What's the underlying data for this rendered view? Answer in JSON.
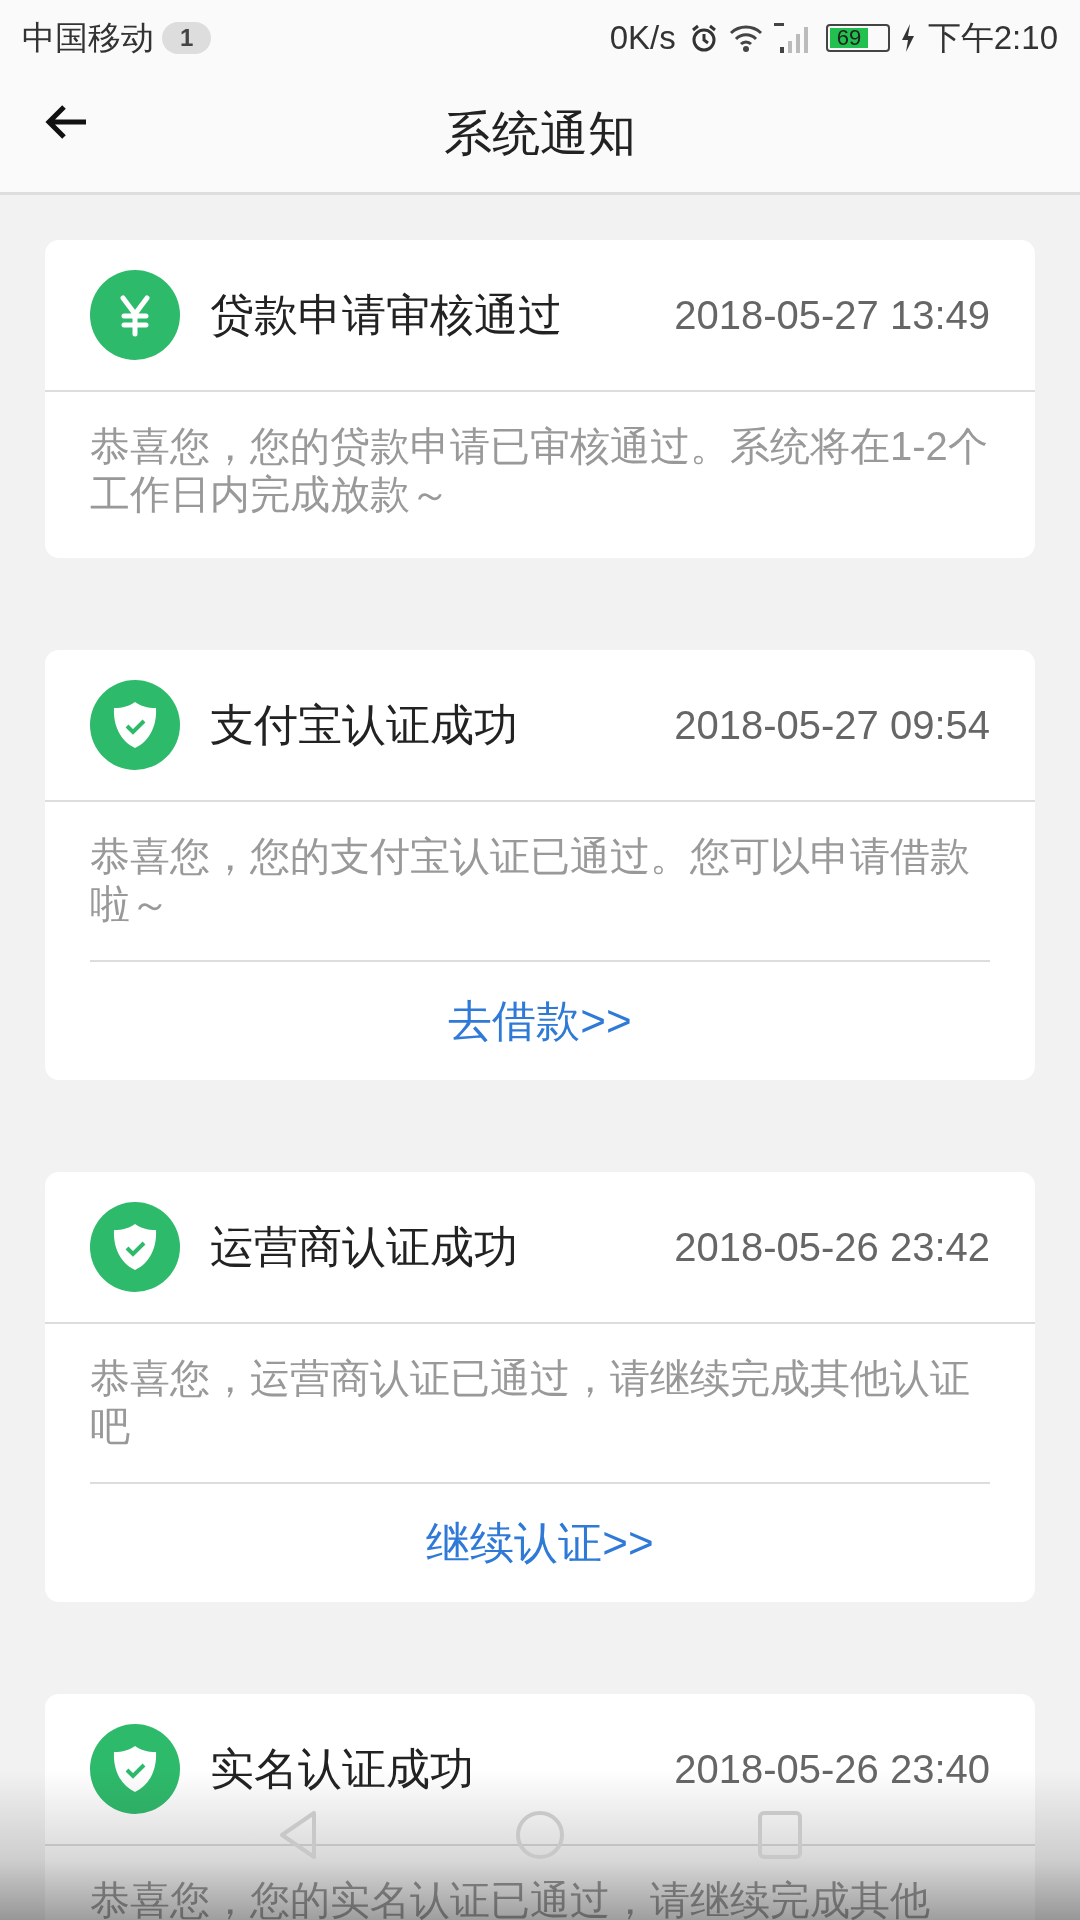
{
  "status_bar": {
    "carrier": "中国移动",
    "notification_count": "1",
    "net_speed": "0K/s",
    "battery": "69",
    "time": "下午2:10"
  },
  "header": {
    "title": "系统通知"
  },
  "notifications": [
    {
      "kind": "yen",
      "title": "贷款申请审核通过",
      "time": "2018-05-27 13:49",
      "body": "恭喜您，您的贷款申请已审核通过。系统将在1-2个工作日内完成放款～"
    },
    {
      "kind": "shield",
      "title": "支付宝认证成功",
      "time": "2018-05-27 09:54",
      "body": "恭喜您，您的支付宝认证已通过。您可以申请借款啦～",
      "action": "去借款>>"
    },
    {
      "kind": "shield",
      "title": "运营商认证成功",
      "time": "2018-05-26 23:42",
      "body": "恭喜您，运营商认证已通过，请继续完成其他认证吧",
      "action": "继续认证>>"
    },
    {
      "kind": "shield",
      "title": "实名认证成功",
      "time": "2018-05-26 23:40",
      "body": "恭喜您，您的实名认证已通过，请继续完成其他"
    }
  ]
}
